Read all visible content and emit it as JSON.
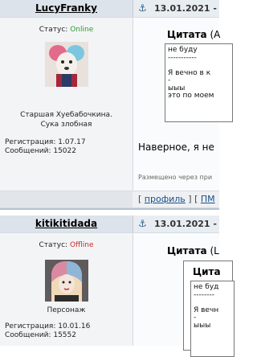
{
  "posts": [
    {
      "author": "LucyFranky",
      "status_label": "Статус:",
      "status_value": "Online",
      "rank_line1": "Старшая Хуебабочкина.",
      "rank_line2": "Сука злобная",
      "registration_label": "Регистрация:",
      "registration_value": "1.07.17",
      "messages_label": "Сообщений:",
      "messages_value": "15022",
      "date": "13.01.2021 -",
      "quote_title": "Цитата",
      "quote_rest": " (A",
      "quote_lines": [
        "не буду",
        "-----------",
        "",
        "Я вечно в к",
        "-",
        "ыыы",
        "это по моем"
      ],
      "body": "Наверное, я не",
      "meta": "Размещено через при",
      "actions": {
        "open": "[",
        "profile": "профиль",
        "mid": "] [",
        "pm": "ПМ"
      }
    },
    {
      "author": "kitikitidada",
      "status_label": "Статус:",
      "status_value": "Offline",
      "rank_line1": "Персонаж",
      "registration_label": "Регистрация:",
      "registration_value": "10.01.16",
      "messages_label": "Сообщений:",
      "messages_value": "15552",
      "date": "13.01.2021 -",
      "quote_title": "Цитата",
      "quote_rest": " (L",
      "inner_quote_title": "Цита",
      "quote_lines": [
        "не буд",
        "--------",
        "",
        "Я вечн",
        "-",
        "ыыы"
      ]
    }
  ],
  "colors": {
    "online": "#2e9b2e",
    "offline": "#cc2a2a",
    "link": "#1a4f86"
  }
}
